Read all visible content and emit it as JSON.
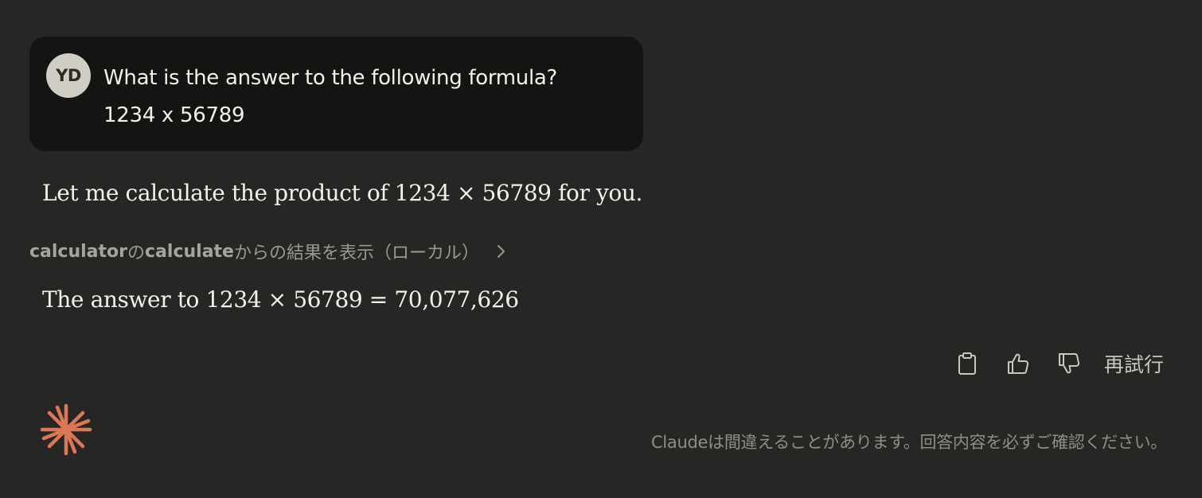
{
  "user_message": {
    "avatar_initials": "YD",
    "lines": [
      "What is the answer to the following formula?",
      "1234 x 56789"
    ]
  },
  "assistant": {
    "intro": "Let me calculate the product of 1234 × 56789 for you.",
    "tool_call": {
      "tool_name": "calculator",
      "connector": "の",
      "function_name": "calculate",
      "suffix": "からの結果を表示（ローカル）"
    },
    "answer": "The answer to 1234 × 56789 = 70,077,626"
  },
  "actions": {
    "copy_icon": "clipboard-icon",
    "like_icon": "thumbs-up-icon",
    "dislike_icon": "thumbs-down-icon",
    "retry_label": "再試行"
  },
  "footer": {
    "disclaimer": "Claudeは間違えることがあります。回答内容を必ずご確認ください。"
  },
  "colors": {
    "background": "#262624",
    "bubble": "#141413",
    "avatar": "#cfcdc4",
    "logo": "#d97757"
  }
}
